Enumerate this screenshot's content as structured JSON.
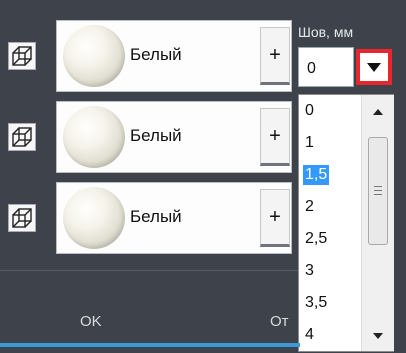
{
  "materials": [
    {
      "label": "Белый",
      "add_label": "+"
    },
    {
      "label": "Белый",
      "add_label": "+"
    },
    {
      "label": "Белый",
      "add_label": "+"
    }
  ],
  "seam": {
    "label": "Шов, мм",
    "value": "0",
    "options": [
      "0",
      "1",
      "1,5",
      "2",
      "2,5",
      "3",
      "3,5",
      "4"
    ],
    "selected_option": "1,5"
  },
  "buttons": {
    "ok": "OK",
    "cancel_partial": "От"
  },
  "colors": {
    "highlight": "#e8262e",
    "selection": "#3399ff",
    "panel_bg": "#3e434b",
    "accent_bar": "#3b9ad9"
  }
}
